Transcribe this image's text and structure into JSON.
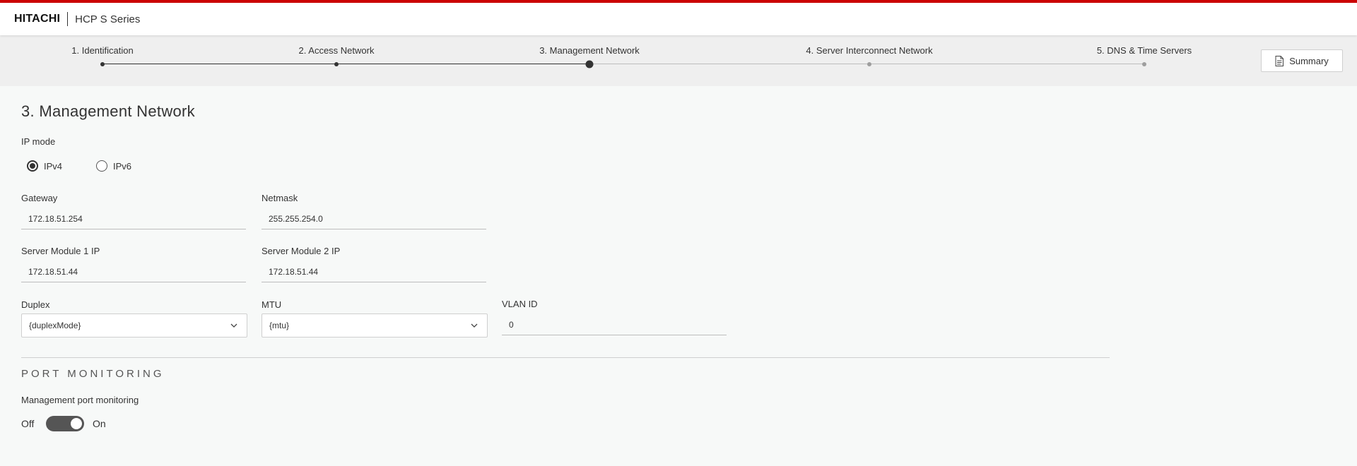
{
  "header": {
    "logo": "HITACHI",
    "product": "HCP S Series"
  },
  "stepper": {
    "steps": [
      {
        "label": "1. Identification",
        "state": "complete"
      },
      {
        "label": "2. Access Network",
        "state": "complete"
      },
      {
        "label": "3. Management Network",
        "state": "current"
      },
      {
        "label": "4. Server Interconnect Network",
        "state": "upcoming"
      },
      {
        "label": "5. DNS & Time Servers",
        "state": "upcoming"
      }
    ],
    "summary_label": "Summary"
  },
  "page": {
    "title": "3.  Management Network"
  },
  "ip_mode": {
    "label": "IP mode",
    "options": [
      "IPv4",
      "IPv6"
    ],
    "selected": "IPv4"
  },
  "form": {
    "gateway": {
      "label": "Gateway",
      "value": "172.18.51.254"
    },
    "netmask": {
      "label": "Netmask",
      "value": "255.255.254.0"
    },
    "server1": {
      "label": "Server Module 1 IP",
      "value": "172.18.51.44"
    },
    "server2": {
      "label": "Server Module 2 IP",
      "value": "172.18.51.44"
    },
    "duplex": {
      "label": "Duplex",
      "value": "{duplexMode}"
    },
    "mtu": {
      "label": "MTU",
      "value": "{mtu}"
    },
    "vlan": {
      "label": "VLAN ID",
      "value": "0"
    }
  },
  "port_monitoring": {
    "section_title": "PORT MONITORING",
    "label": "Management port monitoring",
    "off_label": "Off",
    "on_label": "On",
    "enabled": true
  },
  "colors": {
    "brand_red": "#cc0000",
    "step_active": "#333333",
    "step_inactive": "#9e9e9e"
  }
}
